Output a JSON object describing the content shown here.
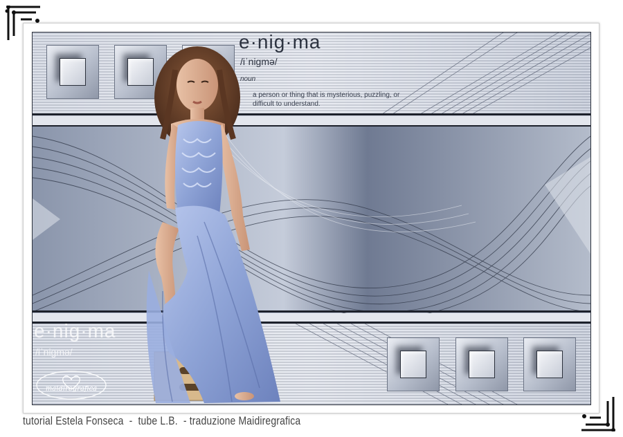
{
  "dictionary": {
    "word": "e·nig·ma",
    "pronunciation": "/iˈnigmə/",
    "part_of_speech": "noun",
    "definition_line1": "a person or thing that is mysterious, puzzling, or",
    "definition_line2": "difficult to understand."
  },
  "ghost_text": {
    "word": "e·nig·ma",
    "pronunciation": "/iˈnigmə/"
  },
  "watermark": {
    "signature": "maidiregrafica"
  },
  "credits": {
    "text": "tutorial Estela Fonseca  -  tube L.B.  - traduzione Maidiregrafica"
  },
  "colors": {
    "accent_blue": "#9fb0d8",
    "frame_dark": "#2a2f3a",
    "background_gray": "#c9d0de"
  },
  "icons": [
    "corner-ornament-icon",
    "square-tile-icon",
    "heart-icon"
  ]
}
